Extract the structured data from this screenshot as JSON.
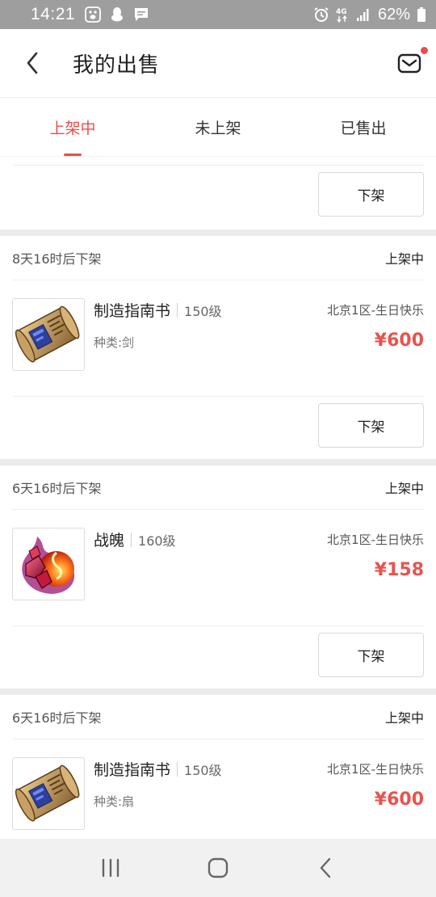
{
  "status_bar": {
    "time": "14:21",
    "battery": "62%",
    "network": "4G"
  },
  "header": {
    "title": "我的出售"
  },
  "tabs": [
    {
      "label": "上架中",
      "active": true
    },
    {
      "label": "未上架",
      "active": false
    },
    {
      "label": "已售出",
      "active": false
    }
  ],
  "top_action": {
    "button_label": "下架"
  },
  "listings": [
    {
      "countdown": "8天16时后下架",
      "status": "上架中",
      "name": "制造指南书",
      "level": "150级",
      "type": "种类:剑",
      "server": "北京1区-生日快乐",
      "price": "¥600",
      "icon": "scroll-icon",
      "button_label": "下架"
    },
    {
      "countdown": "6天16时后下架",
      "status": "上架中",
      "name": "战魄",
      "level": "160级",
      "type": "",
      "server": "北京1区-生日快乐",
      "price": "¥158",
      "icon": "crystal-fire-icon",
      "button_label": "下架"
    },
    {
      "countdown": "6天16时后下架",
      "status": "上架中",
      "name": "制造指南书",
      "level": "150级",
      "type": "种类:扇",
      "server": "北京1区-生日快乐",
      "price": "¥600",
      "icon": "scroll-icon"
    }
  ],
  "colors": {
    "accent": "#ef4b4b",
    "price": "#e8534f",
    "status_bar_bg": "#9e9e9e",
    "separator": "#ebebeb"
  }
}
